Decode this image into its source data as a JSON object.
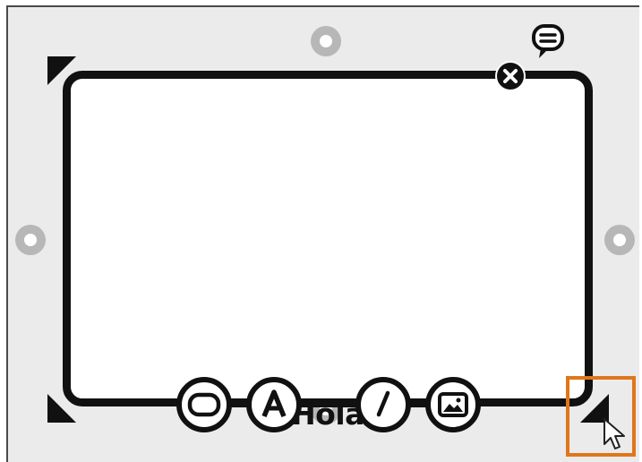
{
  "card": {
    "text": "Hola"
  },
  "icons": {
    "comment": "speech-bubble-icon",
    "close": "close-icon",
    "shape": "rounded-rectangle-icon",
    "text": "letter-a-icon",
    "draw": "pencil-icon",
    "image": "picture-icon",
    "cursor": "mouse-pointer-icon"
  },
  "colors": {
    "background": "#ebebeb",
    "card_border": "#111111",
    "handle": "#b7b7b7",
    "highlight": "#e0761b"
  }
}
